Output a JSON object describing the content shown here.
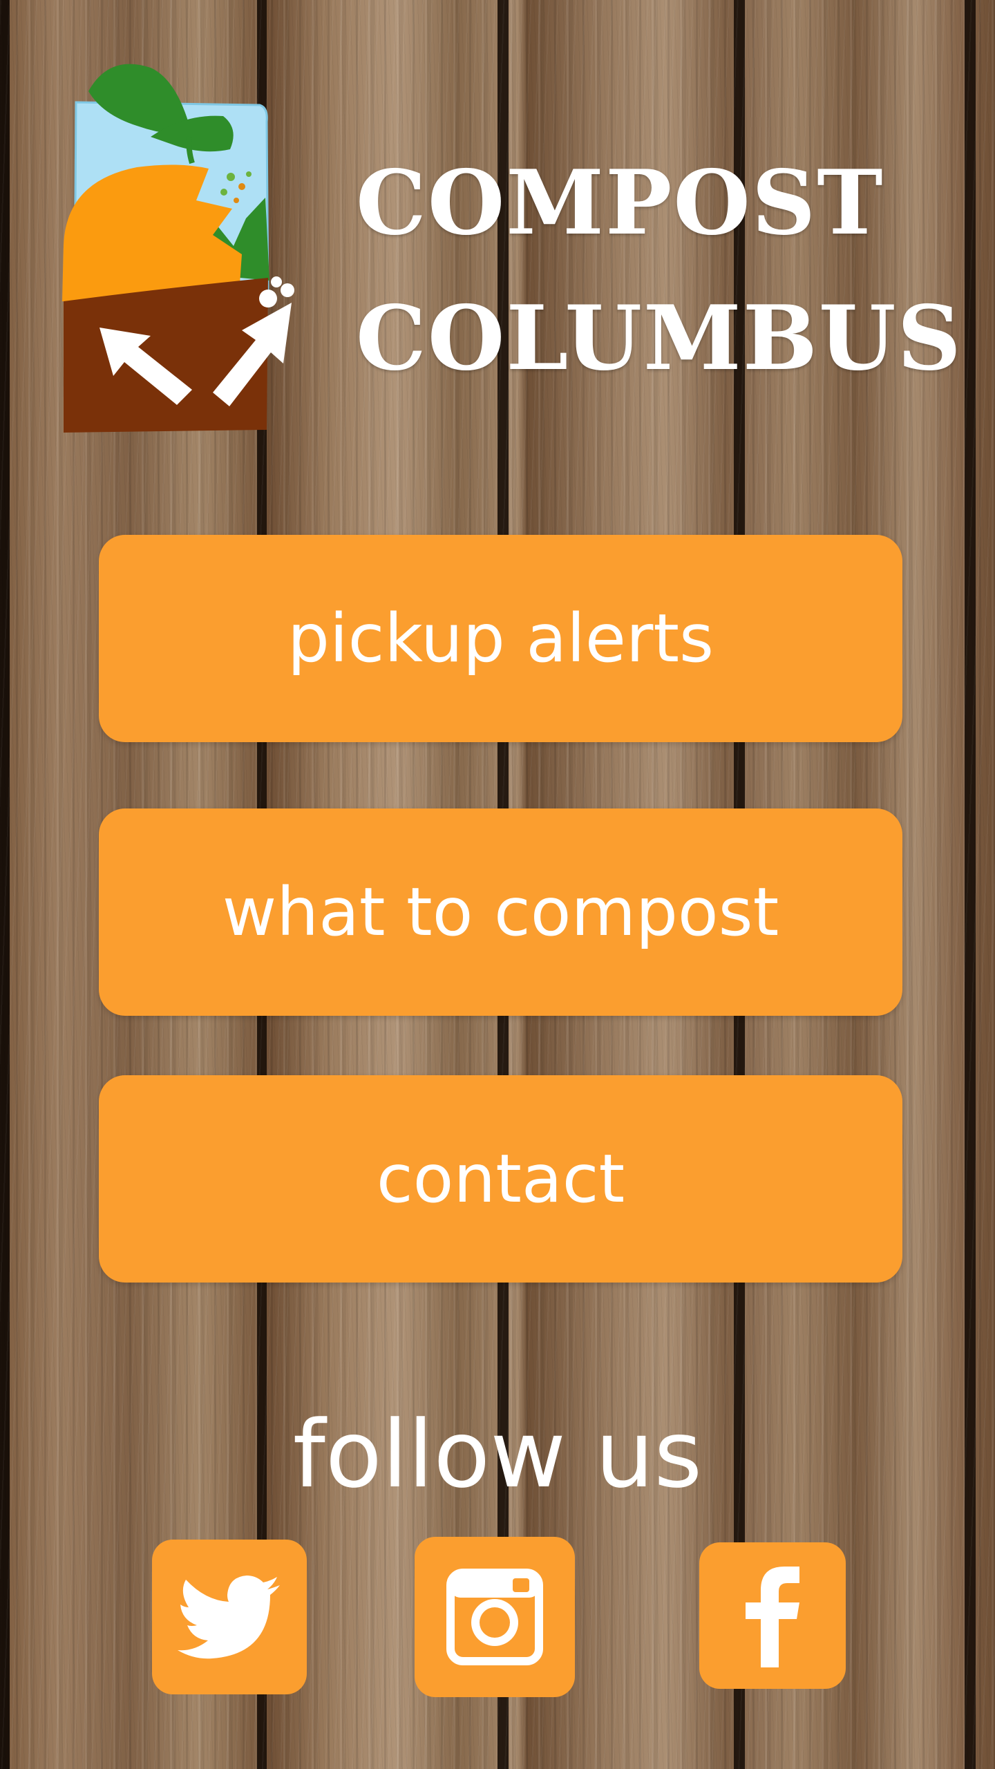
{
  "app": {
    "title_line1": "COMPOST",
    "title_line2": "COLUMBUS"
  },
  "menu": {
    "pickup_alerts": "pickup alerts",
    "what_to_compost": "what to compost",
    "contact": "contact"
  },
  "social": {
    "heading": "follow us",
    "icons": [
      "twitter-icon",
      "instagram-icon",
      "facebook-icon"
    ]
  },
  "colors": {
    "button_orange": "#fb9e2f",
    "text_white": "#ffffff",
    "logo_sky": "#aee0f5",
    "logo_leaf": "#2f8d2a",
    "logo_orange": "#fb9b0f",
    "logo_soil": "#7a3109"
  }
}
